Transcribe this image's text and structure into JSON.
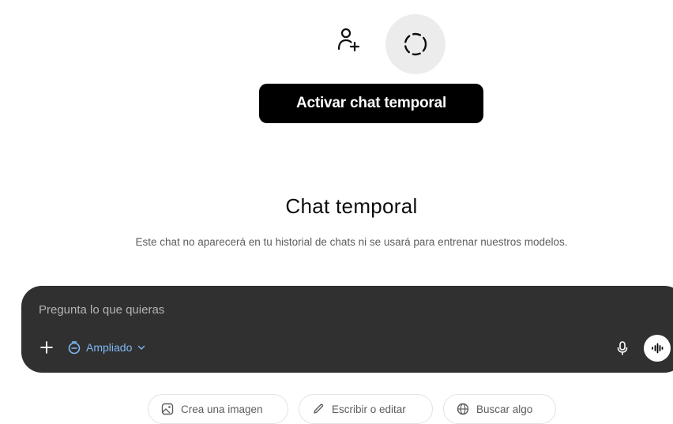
{
  "header": {
    "add_people_icon": "person-plus-icon",
    "temp_chat_icon": "dashed-circle-icon",
    "tooltip": "Activar chat temporal"
  },
  "main": {
    "title": "Chat temporal",
    "subtitle": "Este chat no aparecerá en tu historial de chats ni se usará para entrenar nuestros modelos."
  },
  "composer": {
    "placeholder": "Pregunta lo que quieras",
    "mode_label": "Ampliado",
    "accent": "#7fb8f5",
    "background": "#303030"
  },
  "suggestions": [
    {
      "label": "Crea una imagen",
      "icon": "image-icon"
    },
    {
      "label": "Escribir o editar",
      "icon": "pencil-icon"
    },
    {
      "label": "Buscar algo",
      "icon": "globe-icon"
    }
  ]
}
